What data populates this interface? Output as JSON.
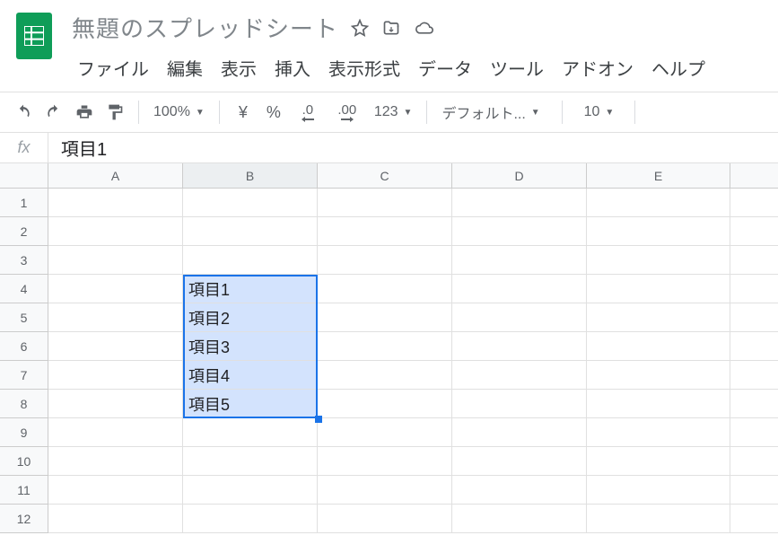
{
  "doc": {
    "title": "無題のスプレッドシート"
  },
  "menus": {
    "file": "ファイル",
    "edit": "編集",
    "view": "表示",
    "insert": "挿入",
    "format": "表示形式",
    "data": "データ",
    "tools": "ツール",
    "addons": "アドオン",
    "help": "ヘルプ"
  },
  "toolbar": {
    "zoom": "100%",
    "currency": "¥",
    "percent": "%",
    "dec_dec": ".0",
    "inc_dec": ".00",
    "numfmt": "123",
    "font": "デフォルト...",
    "fontsize": "10"
  },
  "formula": {
    "fx": "fx",
    "value": "項目1"
  },
  "columns": [
    "A",
    "B",
    "C",
    "D",
    "E"
  ],
  "rows": [
    "1",
    "2",
    "3",
    "4",
    "5",
    "6",
    "7",
    "8",
    "9",
    "10",
    "11",
    "12"
  ],
  "cells": {
    "B4": "項目1",
    "B5": "項目2",
    "B6": "項目3",
    "B7": "項目4",
    "B8": "項目5"
  },
  "selection": {
    "active": "B4",
    "range": "B4:B8"
  }
}
